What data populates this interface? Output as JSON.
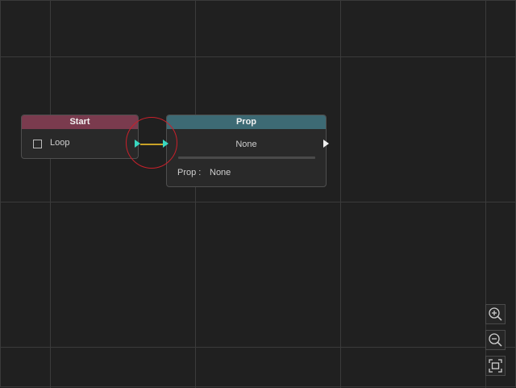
{
  "nodes": {
    "start": {
      "title": "Start",
      "loop_label": "Loop",
      "header_color": "#7a3b4e"
    },
    "prop": {
      "title": "Prop",
      "value": "None",
      "field_label": "Prop :",
      "field_value": "None",
      "header_color": "#3d6a74"
    }
  },
  "connection": {
    "color": "#c9a227",
    "port_color": "#39d7c0"
  },
  "highlight_color": "#c8202b",
  "controls": {
    "zoom_in_icon": "zoom-in-icon",
    "zoom_out_icon": "zoom-out-icon",
    "fit_view_icon": "fit-view-icon"
  }
}
